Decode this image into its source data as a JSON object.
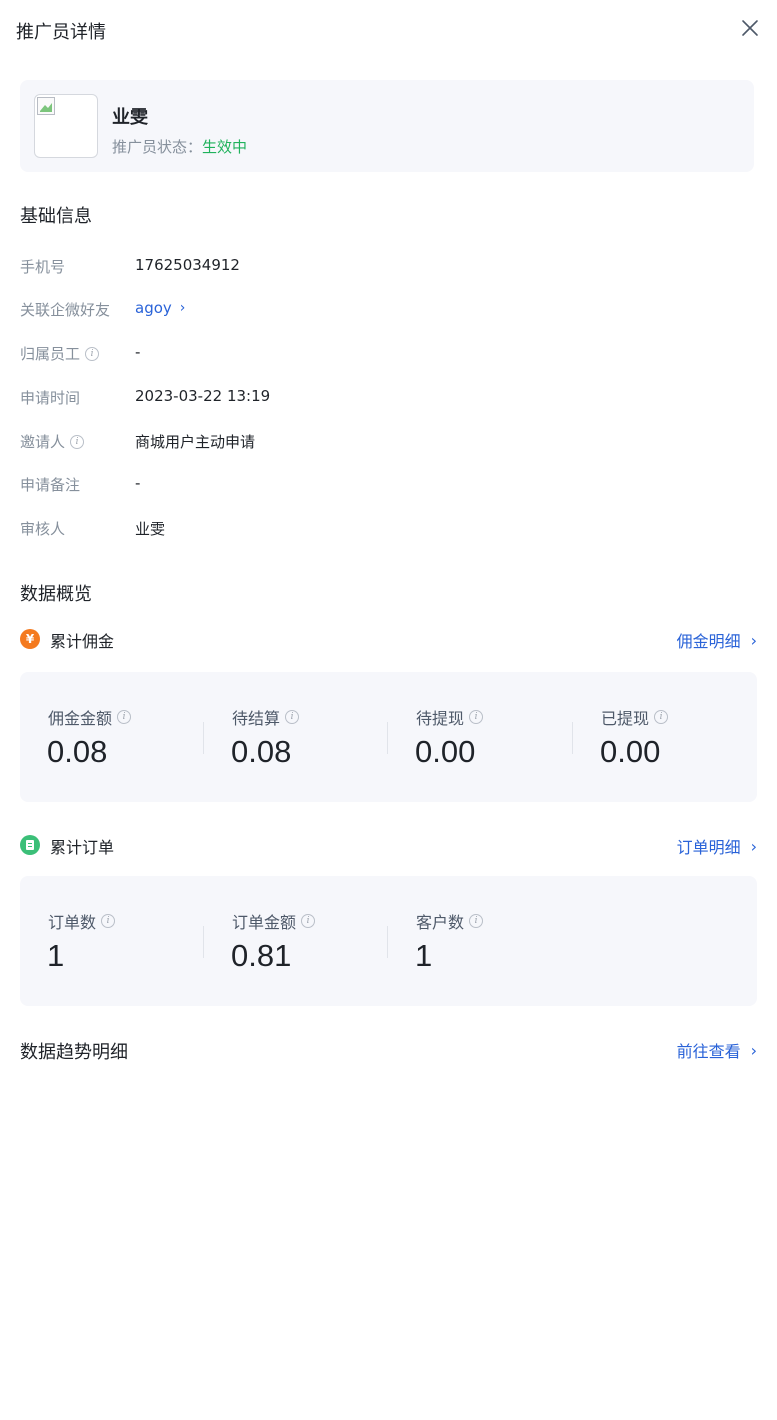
{
  "header": {
    "title": "推广员详情"
  },
  "profile": {
    "name": "业雯",
    "status_label": "推广员状态：",
    "status_value": "生效中",
    "status_color": "#20b25c"
  },
  "basic_info": {
    "title": "基础信息",
    "rows": [
      {
        "label": "手机号",
        "value": "17625034912"
      },
      {
        "label": "关联企微好友",
        "value": "agoy"
      },
      {
        "label": "归属员工",
        "value": "-"
      },
      {
        "label": "申请时间",
        "value": "2023-03-22 13:19"
      },
      {
        "label": "邀请人",
        "value": "商城用户主动申请"
      },
      {
        "label": "申请备注",
        "value": "-"
      },
      {
        "label": "审核人",
        "value": "业雯"
      }
    ]
  },
  "overview": {
    "title": "数据概览",
    "commission": {
      "badge": "¥",
      "title": "累计佣金",
      "link": "佣金明细",
      "stats": [
        {
          "label": "佣金金额",
          "value": "0.08"
        },
        {
          "label": "待结算",
          "value": "0.08"
        },
        {
          "label": "待提现",
          "value": "0.00"
        },
        {
          "label": "已提现",
          "value": "0.00"
        }
      ]
    },
    "orders": {
      "title": "累计订单",
      "link": "订单明细",
      "stats": [
        {
          "label": "订单数",
          "value": "1"
        },
        {
          "label": "订单金额",
          "value": "0.81"
        },
        {
          "label": "客户数",
          "value": "1"
        }
      ]
    }
  },
  "trend": {
    "title": "数据趋势明细",
    "link": "前往查看"
  },
  "colors": {
    "accent": "#2a63d8",
    "commission_badge": "#f47a1f",
    "order_badge": "#3bbf78",
    "panel_bg": "#f6f7fb"
  }
}
